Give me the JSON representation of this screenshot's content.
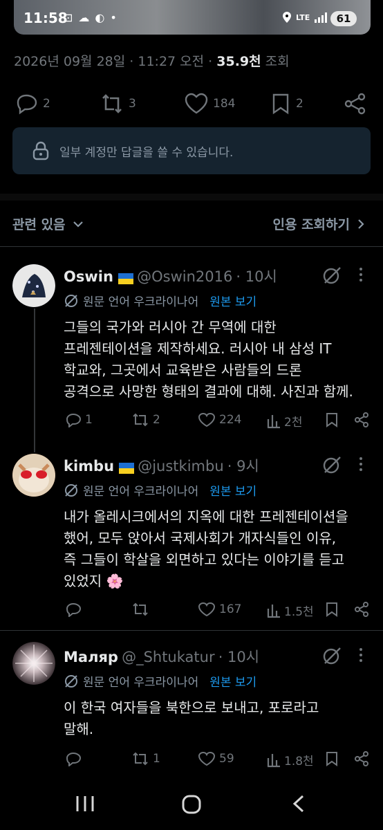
{
  "status": {
    "time": "11:58",
    "battery": "61",
    "network": "LTE"
  },
  "meta": {
    "date": "2026년 09월 28일",
    "time": "11:27 오전",
    "views": "35.9천",
    "views_suffix": "조회"
  },
  "actions": {
    "replies": "2",
    "reposts": "3",
    "likes": "184",
    "bookmarks": "2"
  },
  "reply_notice": "일부 계정만 답글을 쓸 수 있습니다.",
  "related": {
    "label": "관련 있음",
    "quotes_label": "인용 조회하기"
  },
  "tweets": [
    {
      "name": "Oswin",
      "handle": "@Oswin2016",
      "time": "· 10시",
      "translate_label": "원문 언어 우크라이나어",
      "translate_link": "원본 보기",
      "lines": [
        "그들의 국가와 러시아 간 무역에 대한",
        "프레젠테이션을 제작하세요. 러시아 내 삼성 IT",
        "학교와, 그곳에서 교육받은 사람들의 드론",
        "공격으로 사망한 형태의 결과에 대해. 사진과 함께."
      ],
      "replies": "1",
      "reposts": "2",
      "likes": "224",
      "views": "2천"
    },
    {
      "name": "kimbu",
      "handle": "@justkimbu",
      "time": "· 9시",
      "translate_label": "원문 언어 우크라이나어",
      "translate_link": "원본 보기",
      "lines": [
        "내가 올레시크에서의 지옥에 대한 프레젠테이션을",
        "했어, 모두 앉아서 국제사회가 개자식들인 이유,",
        "즉 그들이 학살을 외면하고 있다는 이야기를 듣고",
        "있었지 🌸"
      ],
      "replies": "",
      "reposts": "",
      "likes": "167",
      "views": "1.5천"
    },
    {
      "name": "Маляр",
      "handle": "@_Shtukatur",
      "time": "· 10시",
      "translate_label": "원문 언어 우크라이나어",
      "translate_link": "원본 보기",
      "lines": [
        "이 한국 여자들을 북한으로 보내고, 포로라고",
        "말해."
      ],
      "replies": "",
      "reposts": "1",
      "likes": "59",
      "views": "1.8천"
    }
  ],
  "colors": {
    "accent": "#1d9bf0",
    "muted": "#71767b",
    "text": "#e7e9ea",
    "notice_bg": "#15232f"
  }
}
